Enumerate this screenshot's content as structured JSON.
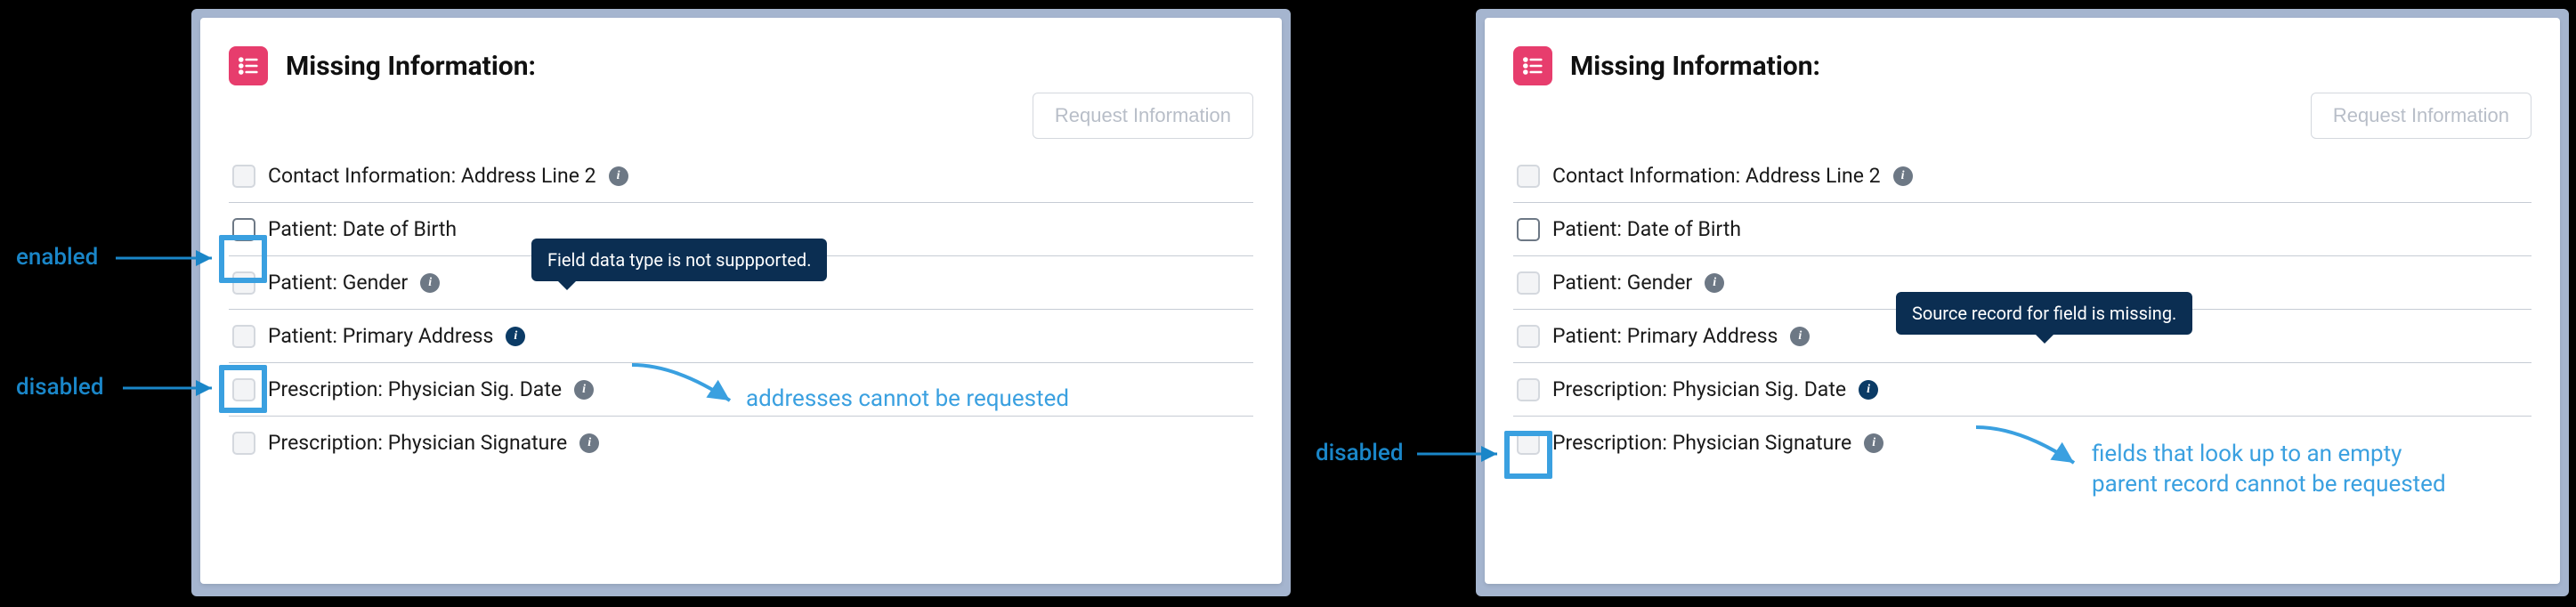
{
  "callouts": {
    "enabled": "enabled",
    "disabled": "disabled"
  },
  "panel": {
    "title": "Missing Information:",
    "request_btn": "Request Information",
    "rows": [
      {
        "label": "Contact Information: Address Line 2",
        "has_info": true,
        "enabled": false
      },
      {
        "label": "Patient: Date of Birth",
        "has_info": false,
        "enabled": true
      },
      {
        "label": "Patient: Gender",
        "has_info": true,
        "enabled": false
      },
      {
        "label": "Patient: Primary Address",
        "has_info": true,
        "enabled": false
      },
      {
        "label": "Prescription: Physician Sig. Date",
        "has_info": true,
        "enabled": false
      },
      {
        "label": "Prescription: Physician Signature",
        "has_info": true,
        "enabled": false
      }
    ]
  },
  "left": {
    "tooltip": "Field data type is not suppported.",
    "caption": "addresses cannot be requested"
  },
  "right": {
    "tooltip": "Source record for field is missing.",
    "caption_line1": "fields that look up to an empty",
    "caption_line2": "parent record cannot be requested"
  }
}
